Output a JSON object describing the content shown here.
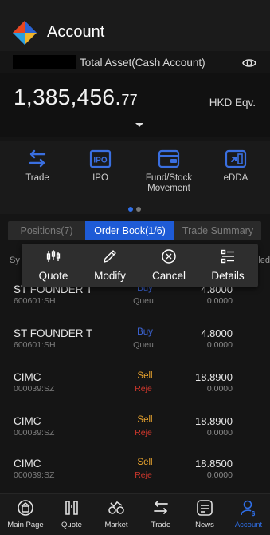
{
  "header": {
    "title": "Account"
  },
  "asset": {
    "label": "Total Asset(Cash Account)",
    "value_main": "1,385,456.",
    "value_decimal": "77",
    "currency": "HKD Eqv."
  },
  "shortcuts": [
    {
      "label": "Trade",
      "icon": "trade-icon"
    },
    {
      "label": "IPO",
      "icon": "ipo-icon"
    },
    {
      "label": "Fund/Stock\nMovement",
      "icon": "wallet-icon"
    },
    {
      "label": "eDDA",
      "icon": "edda-icon"
    }
  ],
  "tabs": [
    {
      "label": "Positions(7)",
      "active": false
    },
    {
      "label": "Order Book(1/6)",
      "active": true
    },
    {
      "label": "Trade Summary",
      "active": false
    }
  ],
  "table_header": {
    "left": "Sy",
    "right": "led"
  },
  "popup": [
    {
      "label": "Quote",
      "icon": "candlestick-icon"
    },
    {
      "label": "Modify",
      "icon": "pencil-icon"
    },
    {
      "label": "Cancel",
      "icon": "cancel-circle-icon"
    },
    {
      "label": "Details",
      "icon": "list-details-icon"
    }
  ],
  "orders": [
    {
      "name": "ST FOUNDER T",
      "code": "600601:SH",
      "side": "Buy",
      "status": "Queu",
      "price": "4.8000",
      "qty": "0.0000"
    },
    {
      "name": "ST FOUNDER T",
      "code": "600601:SH",
      "side": "Buy",
      "status": "Queu",
      "price": "4.8000",
      "qty": "0.0000"
    },
    {
      "name": "CIMC",
      "code": "000039:SZ",
      "side": "Sell",
      "status": "Reje",
      "price": "18.8900",
      "qty": "0.0000"
    },
    {
      "name": "CIMC",
      "code": "000039:SZ",
      "side": "Sell",
      "status": "Reje",
      "price": "18.8900",
      "qty": "0.0000"
    },
    {
      "name": "CIMC",
      "code": "000039:SZ",
      "side": "Sell",
      "status": "Reje",
      "price": "18.8500",
      "qty": "0.0000"
    }
  ],
  "tabbar": [
    {
      "label": "Main Page",
      "icon": "home-icon",
      "active": false
    },
    {
      "label": "Quote",
      "icon": "quote-icon",
      "active": false
    },
    {
      "label": "Market",
      "icon": "market-icon",
      "active": false
    },
    {
      "label": "Trade",
      "icon": "trade-icon",
      "active": false
    },
    {
      "label": "News",
      "icon": "news-icon",
      "active": false
    },
    {
      "label": "Account",
      "icon": "account-icon",
      "active": true
    }
  ],
  "colors": {
    "accent": "#1e5bd6",
    "buy": "#3d66d9",
    "sell": "#e8a32e",
    "reject": "#d0382d"
  }
}
